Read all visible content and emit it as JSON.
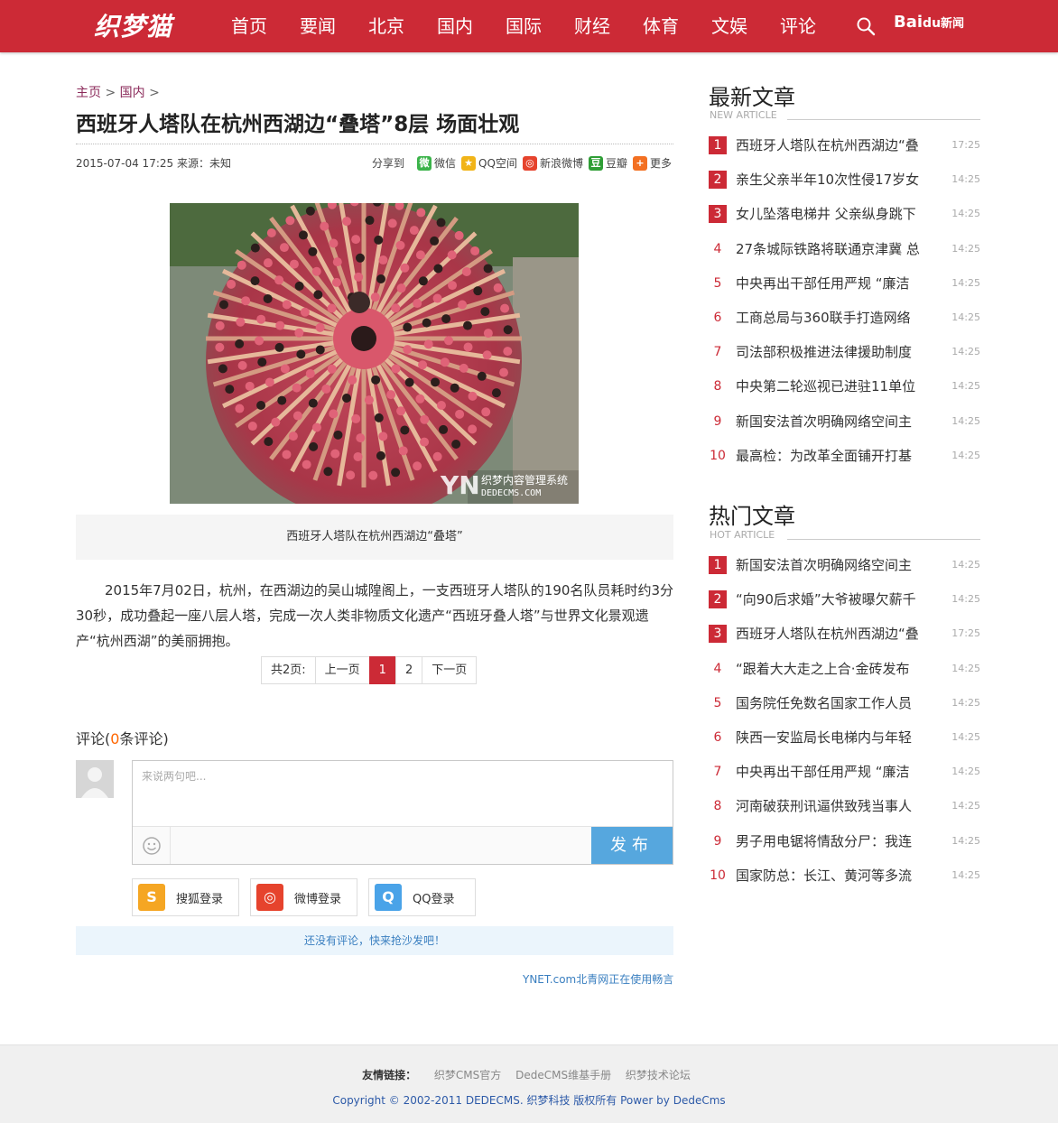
{
  "header": {
    "logo_text": "织梦猫",
    "nav": [
      "首页",
      "要闻",
      "北京",
      "国内",
      "国际",
      "财经",
      "体育",
      "文娱",
      "评论"
    ],
    "baidu_text": "Bai",
    "baidu_paw": "du",
    "baidu_news": "新闻"
  },
  "breadcrumb": {
    "home": "主页",
    "sep": ">",
    "section": "国内"
  },
  "article": {
    "title": "西班牙人塔队在杭州西湖边“叠塔”8层 场面壮观",
    "meta": "2015-07-04 17:25 来源：未知",
    "share_label": "分享到",
    "share_items": [
      {
        "label": "微信",
        "color": "#3bb34a",
        "glyph": "微"
      },
      {
        "label": "QQ空间",
        "color": "#f1b418",
        "glyph": "★"
      },
      {
        "label": "新浪微博",
        "color": "#e6432d",
        "glyph": "◎"
      },
      {
        "label": "豆瓣",
        "color": "#2f9e36",
        "glyph": "豆"
      },
      {
        "label": "更多",
        "color": "#f37022",
        "glyph": "+"
      }
    ],
    "photo_watermark": "YN 织梦内容管理系统 DEDECMS.COM",
    "caption": "西班牙人塔队在杭州西湖边“叠塔”",
    "body": "2015年7月02日，杭州，在西湖边的吴山城隍阁上，一支西班牙人塔队的190名队员耗时约3分30秒，成功叠起一座八层人塔，完成一次人类非物质文化遗产“西班牙叠人塔”与世界文化景观遗产“杭州西湖”的美丽拥抱。"
  },
  "pager": {
    "total": "共2页:",
    "prev": "上一页",
    "page1": "1",
    "page2": "2",
    "next": "下一页"
  },
  "comments": {
    "title_prefix": "评论(",
    "count": "0",
    "title_suffix": "条评论)",
    "placeholder": "来说两句吧...",
    "publish": "发布",
    "logins": [
      {
        "label": "搜狐登录",
        "color": "#f5a623",
        "glyph": "S"
      },
      {
        "label": "微博登录",
        "color": "#e6432d",
        "glyph": "◎"
      },
      {
        "label": "QQ登录",
        "color": "#4aa3e8",
        "glyph": "Q"
      }
    ],
    "empty": "还没有评论，快来抢沙发吧！",
    "powered": "YNET.com北青网正在使用畅言"
  },
  "latest": {
    "heading": "最新文章",
    "sub": "NEW ARTICLE",
    "items": [
      {
        "n": "1",
        "t": "西班牙人塔队在杭州西湖边“叠",
        "tm": "17:25"
      },
      {
        "n": "2",
        "t": "亲生父亲半年10次性侵17岁女",
        "tm": "14:25"
      },
      {
        "n": "3",
        "t": "女儿坠落电梯井 父亲纵身跳下",
        "tm": "14:25"
      },
      {
        "n": "4",
        "t": "27条城际铁路将联通京津冀 总",
        "tm": "14:25"
      },
      {
        "n": "5",
        "t": "中央再出干部任用严规 “廉洁",
        "tm": "14:25"
      },
      {
        "n": "6",
        "t": "工商总局与360联手打造网络",
        "tm": "14:25"
      },
      {
        "n": "7",
        "t": "司法部积极推进法律援助制度",
        "tm": "14:25"
      },
      {
        "n": "8",
        "t": "中央第二轮巡视已进驻11单位",
        "tm": "14:25"
      },
      {
        "n": "9",
        "t": "新国安法首次明确网络空间主",
        "tm": "14:25"
      },
      {
        "n": "10",
        "t": "最高检：为改革全面铺开打基",
        "tm": "14:25"
      }
    ]
  },
  "hot": {
    "heading": "热门文章",
    "sub": "HOT ARTICLE",
    "items": [
      {
        "n": "1",
        "t": "新国安法首次明确网络空间主",
        "tm": "14:25"
      },
      {
        "n": "2",
        "t": "“向90后求婚”大爷被曝欠薪千",
        "tm": "14:25"
      },
      {
        "n": "3",
        "t": "西班牙人塔队在杭州西湖边“叠",
        "tm": "17:25"
      },
      {
        "n": "4",
        "t": "“跟着大大走之上合·金砖发布",
        "tm": "14:25"
      },
      {
        "n": "5",
        "t": "国务院任免数名国家工作人员",
        "tm": "14:25"
      },
      {
        "n": "6",
        "t": "陕西一安监局长电梯内与年轻",
        "tm": "14:25"
      },
      {
        "n": "7",
        "t": "中央再出干部任用严规 “廉洁",
        "tm": "14:25"
      },
      {
        "n": "8",
        "t": "河南破获刑讯逼供致残当事人",
        "tm": "14:25"
      },
      {
        "n": "9",
        "t": "男子用电锯将情敌分尸：我连",
        "tm": "14:25"
      },
      {
        "n": "10",
        "t": "国家防总：长江、黄河等多流",
        "tm": "14:25"
      }
    ]
  },
  "footer": {
    "links_label": "友情链接：",
    "links": [
      "织梦CMS官方",
      "DedeCMS维基手册",
      "织梦技术论坛"
    ],
    "copyright": "Copyright © 2002-2011 DEDECMS. 织梦科技 版权所有  Power by DedeCms"
  },
  "colors": {
    "brand": "#cc2a36",
    "link": "#3a7fc0",
    "publish": "#56a7de"
  }
}
